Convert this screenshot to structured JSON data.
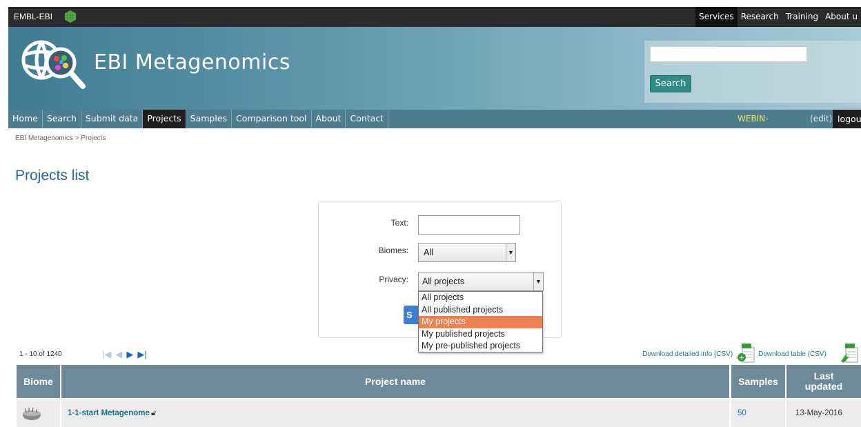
{
  "topbar": {
    "brand": "EMBL-EBI",
    "links": [
      "Services",
      "Research",
      "Training",
      "About u"
    ]
  },
  "header": {
    "title": "EBI Metagenomics",
    "search_value": "",
    "search_button": "Search"
  },
  "nav": {
    "items": [
      "Home",
      "Search",
      "Submit data",
      "Projects",
      "Samples",
      "Comparison tool",
      "About",
      "Contact"
    ],
    "active": "Projects",
    "user": "WEBIN-",
    "edit": "(edit)",
    "logout": "logou"
  },
  "breadcrumb": "EBI Metagenomics > Projects",
  "page_title": "Projects list",
  "filter": {
    "text_label": "Text:",
    "text_value": "",
    "biomes_label": "Biomes:",
    "biomes_value": "All",
    "privacy_label": "Privacy:",
    "privacy_value": "All projects",
    "privacy_options": [
      "All projects",
      "All published projects",
      "My projects",
      "My published projects",
      "My pre-published projects"
    ],
    "highlighted_option": "My projects",
    "submit_partial": "S"
  },
  "pagination": {
    "count": "1 - 10 of 1240"
  },
  "downloads": {
    "detailed": "Download detailed info (CSV)",
    "table": "Download table (CSV)"
  },
  "table": {
    "headers": {
      "biome": "Biome",
      "project_name": "Project name",
      "samples": "Samples",
      "last_updated": "Last updated"
    },
    "rows": [
      {
        "project_name": "1-1-start Metagenome",
        "samples": "50",
        "last_updated": "13-May-2016"
      }
    ]
  },
  "colors": {
    "nav_bg": "#4e7d8f",
    "title_blue": "#246b9f",
    "table_header": "#6e8a99",
    "dropdown_highlight": "#ef8052",
    "webin_yellow": "#f2e25a"
  }
}
